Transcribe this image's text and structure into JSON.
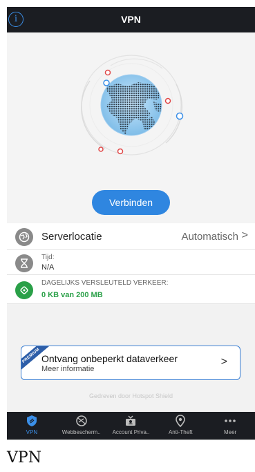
{
  "header": {
    "title": "VPN",
    "info_icon": "i"
  },
  "hero": {
    "button_label": "Verbinden"
  },
  "server": {
    "label": "Serverlocatie",
    "value": "Automatisch",
    "chevron": ">"
  },
  "time": {
    "label": "Tijd:",
    "value": "N/A"
  },
  "traffic": {
    "label": "DAGELIJKS VERSLEUTELD VERKEER:",
    "value": "0 KB van 200 MB"
  },
  "premium": {
    "ribbon": "PREMIUM",
    "title": "Ontvang onbeperkt dataverkeer",
    "subtitle": "Meer informatie",
    "chevron": ">"
  },
  "powered_by": "Gedreven door Hotspot Shield",
  "tabs": [
    {
      "label": "VPN",
      "icon": "shield-icon",
      "active": true
    },
    {
      "label": "Webbescherm..",
      "icon": "web-protection-icon",
      "active": false
    },
    {
      "label": "Account Priva..",
      "icon": "account-privacy-icon",
      "active": false
    },
    {
      "label": "Anti-Theft",
      "icon": "location-pin-icon",
      "active": false
    },
    {
      "label": "Meer",
      "icon": "more-icon",
      "active": false
    }
  ],
  "page_caption": "VPN",
  "colors": {
    "accent": "#2f86e0",
    "topbar": "#1b1d22",
    "success": "#2aa048",
    "premium_border": "#3a7fd3"
  }
}
